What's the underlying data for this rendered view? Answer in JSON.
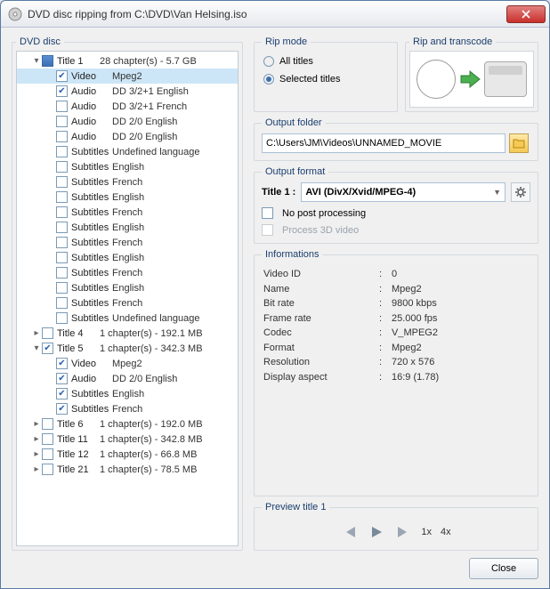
{
  "window": {
    "title": "DVD disc ripping from C:\\DVD\\Van Helsing.iso"
  },
  "tree": {
    "header": "DVD disc",
    "items": [
      {
        "level": 1,
        "twist": "▾",
        "chk": "mix",
        "label": "Title 1",
        "desc": "28 chapter(s) - 5.7 GB",
        "sel": false,
        "labelW": 48
      },
      {
        "level": 2,
        "twist": "",
        "chk": "on",
        "label": "Video",
        "desc": "Mpeg2",
        "sel": true,
        "labelW": 46
      },
      {
        "level": 2,
        "twist": "",
        "chk": "on",
        "label": "Audio",
        "desc": "DD 3/2+1 English",
        "labelW": 46
      },
      {
        "level": 2,
        "twist": "",
        "chk": "off",
        "label": "Audio",
        "desc": "DD 3/2+1 French",
        "labelW": 46
      },
      {
        "level": 2,
        "twist": "",
        "chk": "off",
        "label": "Audio",
        "desc": "DD 2/0 English",
        "labelW": 46
      },
      {
        "level": 2,
        "twist": "",
        "chk": "off",
        "label": "Audio",
        "desc": "DD 2/0 English",
        "labelW": 46
      },
      {
        "level": 2,
        "twist": "",
        "chk": "off",
        "label": "Subtitles",
        "desc": "Undefined language",
        "labelW": 46
      },
      {
        "level": 2,
        "twist": "",
        "chk": "off",
        "label": "Subtitles",
        "desc": "English",
        "labelW": 46
      },
      {
        "level": 2,
        "twist": "",
        "chk": "off",
        "label": "Subtitles",
        "desc": "French",
        "labelW": 46
      },
      {
        "level": 2,
        "twist": "",
        "chk": "off",
        "label": "Subtitles",
        "desc": "English",
        "labelW": 46
      },
      {
        "level": 2,
        "twist": "",
        "chk": "off",
        "label": "Subtitles",
        "desc": "French",
        "labelW": 46
      },
      {
        "level": 2,
        "twist": "",
        "chk": "off",
        "label": "Subtitles",
        "desc": "English",
        "labelW": 46
      },
      {
        "level": 2,
        "twist": "",
        "chk": "off",
        "label": "Subtitles",
        "desc": "French",
        "labelW": 46
      },
      {
        "level": 2,
        "twist": "",
        "chk": "off",
        "label": "Subtitles",
        "desc": "English",
        "labelW": 46
      },
      {
        "level": 2,
        "twist": "",
        "chk": "off",
        "label": "Subtitles",
        "desc": "French",
        "labelW": 46
      },
      {
        "level": 2,
        "twist": "",
        "chk": "off",
        "label": "Subtitles",
        "desc": "English",
        "labelW": 46
      },
      {
        "level": 2,
        "twist": "",
        "chk": "off",
        "label": "Subtitles",
        "desc": "French",
        "labelW": 46
      },
      {
        "level": 2,
        "twist": "",
        "chk": "off",
        "label": "Subtitles",
        "desc": "Undefined language",
        "labelW": 46
      },
      {
        "level": 1,
        "twist": "▸",
        "chk": "off",
        "label": "Title 4",
        "desc": "1 chapter(s) - 192.1 MB",
        "labelW": 48
      },
      {
        "level": 1,
        "twist": "▾",
        "chk": "on",
        "label": "Title 5",
        "desc": "1 chapter(s) - 342.3 MB",
        "labelW": 48
      },
      {
        "level": 2,
        "twist": "",
        "chk": "on",
        "label": "Video",
        "desc": "Mpeg2",
        "labelW": 46
      },
      {
        "level": 2,
        "twist": "",
        "chk": "on",
        "label": "Audio",
        "desc": "DD 2/0 English",
        "labelW": 46
      },
      {
        "level": 2,
        "twist": "",
        "chk": "on",
        "label": "Subtitles",
        "desc": "English",
        "labelW": 46
      },
      {
        "level": 2,
        "twist": "",
        "chk": "on",
        "label": "Subtitles",
        "desc": "French",
        "labelW": 46
      },
      {
        "level": 1,
        "twist": "▸",
        "chk": "off",
        "label": "Title 6",
        "desc": "1 chapter(s) - 192.0 MB",
        "labelW": 48
      },
      {
        "level": 1,
        "twist": "▸",
        "chk": "off",
        "label": "Title 11",
        "desc": "1 chapter(s) - 342.8 MB",
        "labelW": 48
      },
      {
        "level": 1,
        "twist": "▸",
        "chk": "off",
        "label": "Title 12",
        "desc": "1 chapter(s) - 66.8 MB",
        "labelW": 48
      },
      {
        "level": 1,
        "twist": "▸",
        "chk": "off",
        "label": "Title 21",
        "desc": "1 chapter(s) - 78.5 MB",
        "labelW": 48
      }
    ]
  },
  "ripmode": {
    "legend": "Rip mode",
    "all": "All titles",
    "selected": "Selected titles",
    "choice": "selected"
  },
  "transcode": {
    "legend": "Rip and transcode"
  },
  "outfolder": {
    "legend": "Output folder",
    "path": "C:\\Users\\JM\\Videos\\UNNAMED_MOVIE"
  },
  "outformat": {
    "legend": "Output format",
    "title_label": "Title 1 :",
    "value": "AVI (DivX/Xvid/MPEG-4)",
    "nopost": "No post processing",
    "process3d": "Process 3D video"
  },
  "info": {
    "legend": "Informations",
    "rows": [
      {
        "k": "Video ID",
        "v": "0"
      },
      {
        "k": "Name",
        "v": "Mpeg2"
      },
      {
        "k": "Bit rate",
        "v": "9800 kbps"
      },
      {
        "k": "Frame rate",
        "v": "25.000 fps"
      },
      {
        "k": "Codec",
        "v": "V_MPEG2"
      },
      {
        "k": "Format",
        "v": "Mpeg2"
      },
      {
        "k": "Resolution",
        "v": "720 x 576"
      },
      {
        "k": "Display aspect",
        "v": "16:9 (1.78)"
      }
    ]
  },
  "preview": {
    "legend": "Preview title 1",
    "rate1": "1x",
    "rate4": "4x"
  },
  "footer": {
    "close": "Close"
  }
}
